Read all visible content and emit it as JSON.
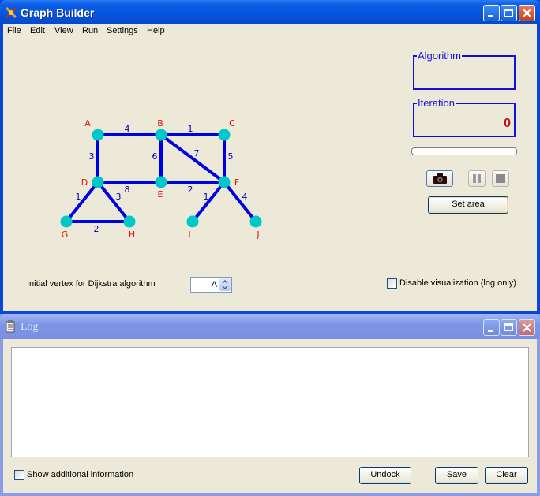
{
  "main_window": {
    "title": "Graph Builder",
    "menu": [
      "File",
      "Edit",
      "View",
      "Run",
      "Settings",
      "Help"
    ]
  },
  "graph": {
    "node_color": "#00c8c8",
    "edge_color": "#0000e0",
    "label_color": "#e01010",
    "weight_color": "#0000b0",
    "nodes": [
      {
        "id": "A"
      },
      {
        "id": "B"
      },
      {
        "id": "C"
      },
      {
        "id": "D"
      },
      {
        "id": "E"
      },
      {
        "id": "F"
      },
      {
        "id": "G"
      },
      {
        "id": "H"
      },
      {
        "id": "I"
      },
      {
        "id": "J"
      }
    ],
    "edges": [
      {
        "from": "A",
        "to": "B",
        "weight": "4"
      },
      {
        "from": "B",
        "to": "C",
        "weight": "1"
      },
      {
        "from": "A",
        "to": "D",
        "weight": "3"
      },
      {
        "from": "B",
        "to": "E",
        "weight": "6"
      },
      {
        "from": "B",
        "to": "F",
        "weight": "7"
      },
      {
        "from": "C",
        "to": "F",
        "weight": "5"
      },
      {
        "from": "D",
        "to": "E",
        "weight": "8"
      },
      {
        "from": "E",
        "to": "F",
        "weight": "2"
      },
      {
        "from": "D",
        "to": "G",
        "weight": "1"
      },
      {
        "from": "D",
        "to": "H",
        "weight": "3"
      },
      {
        "from": "G",
        "to": "H",
        "weight": "2"
      },
      {
        "from": "F",
        "to": "I",
        "weight": "1"
      },
      {
        "from": "F",
        "to": "J",
        "weight": "4"
      }
    ]
  },
  "panel": {
    "algorithm_label": "Algorithm",
    "algorithm_value": "",
    "iteration_label": "Iteration",
    "iteration_value": "0",
    "progress": 0,
    "set_area_label": "Set area",
    "icons": [
      "camera-icon",
      "pause-icon",
      "stop-icon"
    ]
  },
  "controls": {
    "initial_vertex_label": "Initial vertex for Dijkstra algorithm",
    "initial_vertex_value": "A",
    "disable_visualization_label": "Disable visualization (log only)",
    "disable_visualization_checked": false
  },
  "log_window": {
    "title": "Log",
    "content": "",
    "show_additional_label": "Show additional information",
    "show_additional_checked": false,
    "undock_label": "Undock",
    "save_label": "Save",
    "clear_label": "Clear"
  }
}
